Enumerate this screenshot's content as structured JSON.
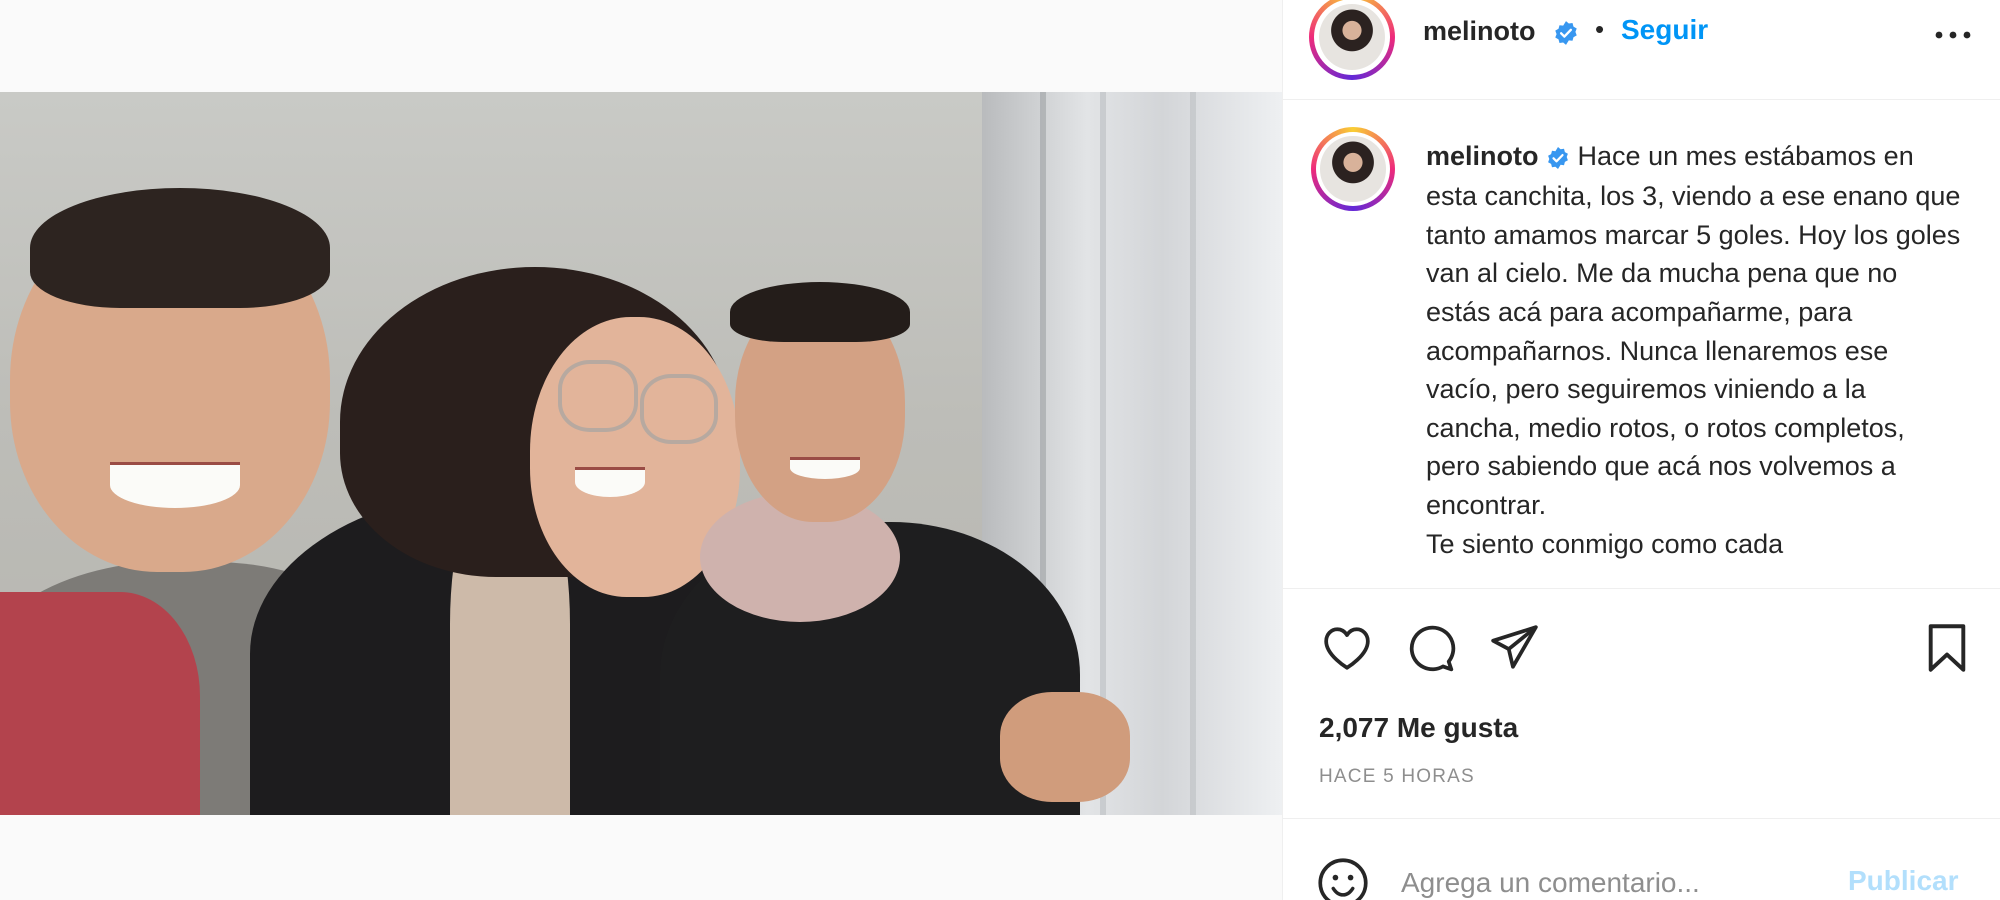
{
  "post": {
    "username": "melinoto",
    "verified": true,
    "follow_label": "Seguir",
    "separator": "•",
    "caption_text": "Hace un mes estábamos en esta canchita, los 3, viendo a ese enano que tanto amamos marcar 5 goles. Hoy los goles van al cielo. Me da mucha pena que no estás acá para acompañarme, para acompañarnos. Nunca llenaremos ese vacío, pero seguiremos viniendo a la cancha, medio rotos, o rotos completos, pero sabiendo que acá nos volvemos a encontrar.\nTe siento conmigo como cada",
    "likes_label": "2,077 Me gusta",
    "time_label": "HACE 5 HORAS"
  },
  "comment": {
    "placeholder": "Agrega un comentario...",
    "publish_label": "Publicar"
  },
  "icons": {
    "header_more": "more-horizontal-icon",
    "like": "heart-icon",
    "comment": "comment-icon",
    "share": "paper-plane-icon",
    "save": "bookmark-icon",
    "emoji": "emoji-icon",
    "user_tag": "user-tag-icon",
    "verified": "verified-badge-icon"
  },
  "colors": {
    "accent": "#0095f6",
    "publish_disabled": "#b2dffc",
    "muted": "#8e8e8e",
    "verified": "#3897f0"
  }
}
